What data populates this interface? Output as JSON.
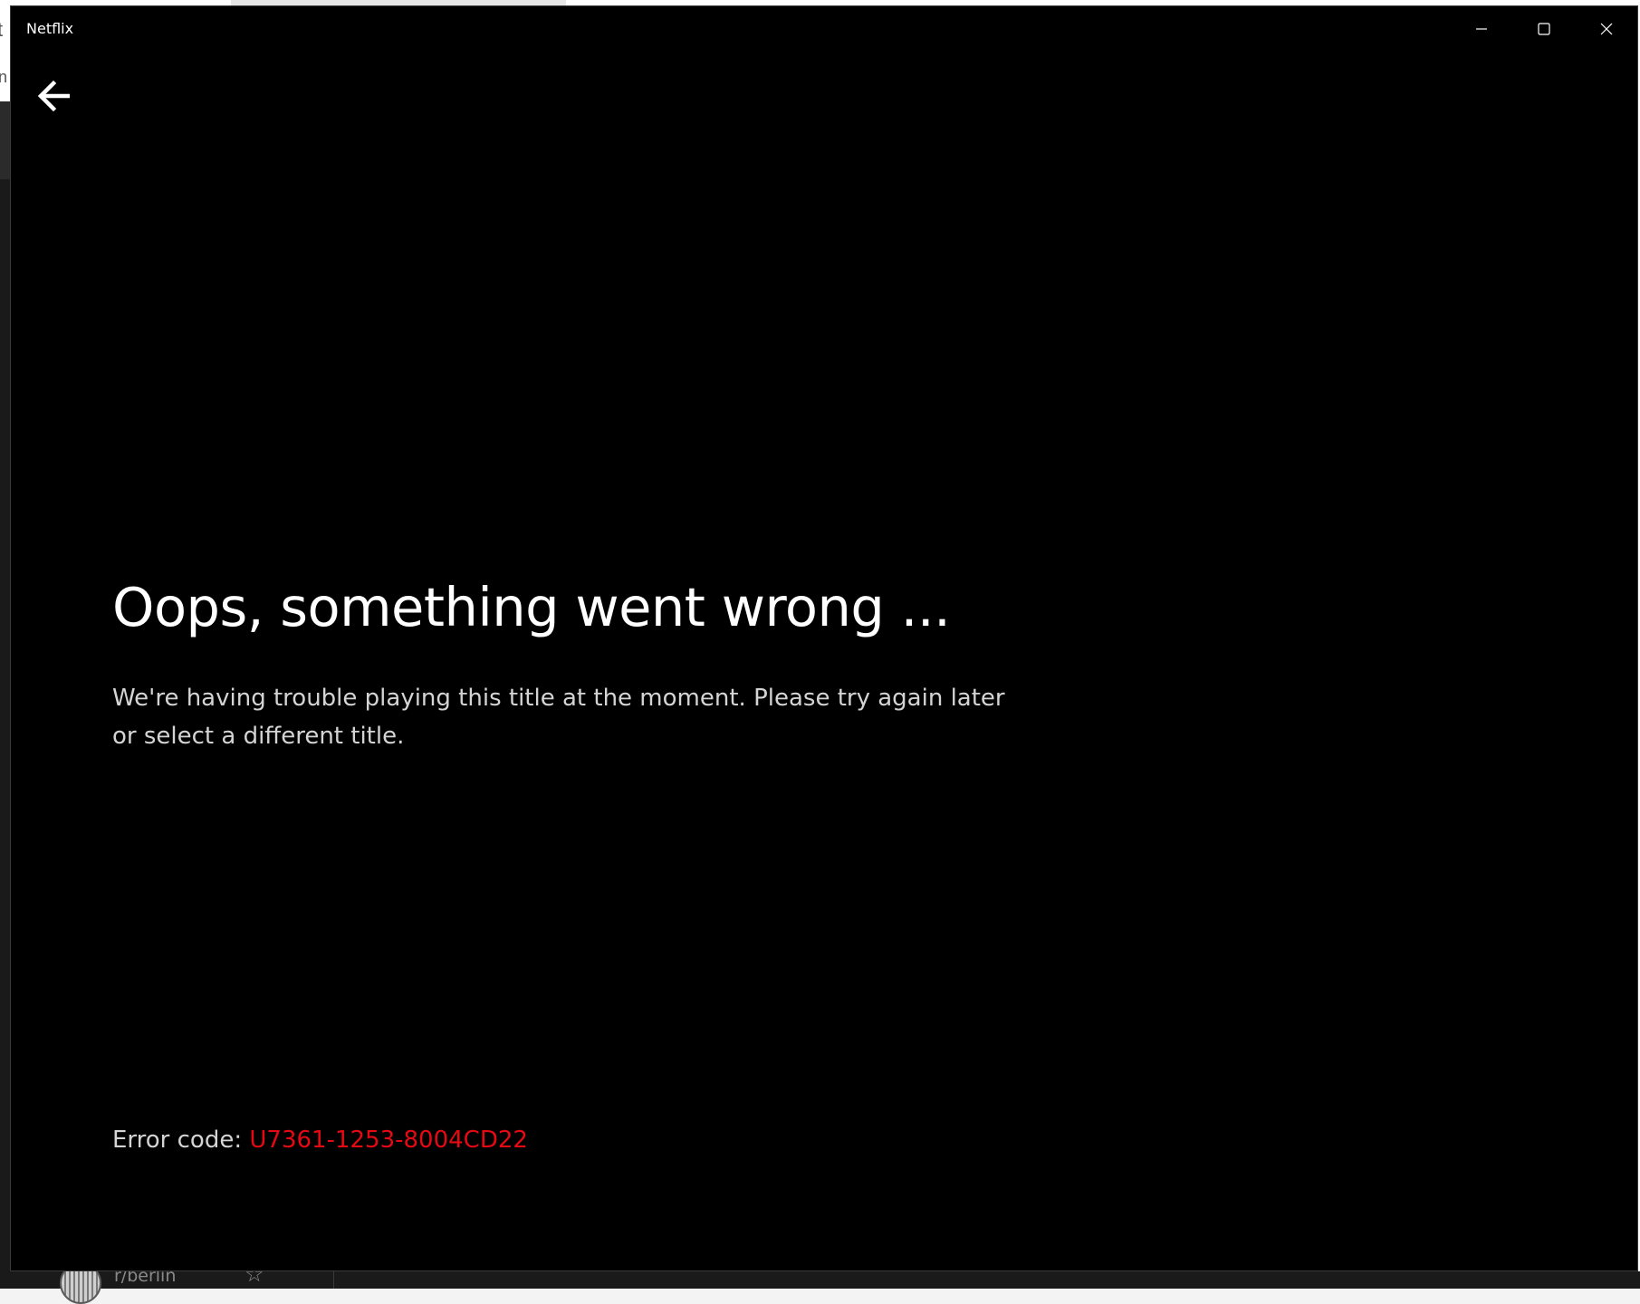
{
  "window": {
    "title": "Netflix",
    "controls": {
      "minimize_icon": "minimize-icon",
      "maximize_icon": "maximize-icon",
      "close_icon": "close-icon"
    }
  },
  "navigation": {
    "back_icon": "arrow-left-icon"
  },
  "error": {
    "title": "Oops, something went wrong ...",
    "message": "We're having trouble playing this title at the moment. Please try again later or select a different title.",
    "code_label": "Error code: ",
    "code_value": "U7361-1253-8004CD22"
  },
  "background_app": {
    "peek_text": "r/berlin",
    "star_icon": "star-icon"
  },
  "colors": {
    "background": "#000000",
    "title_text": "#ffffff",
    "body_text": "#d4d4d4",
    "error_code": "#e50914"
  }
}
